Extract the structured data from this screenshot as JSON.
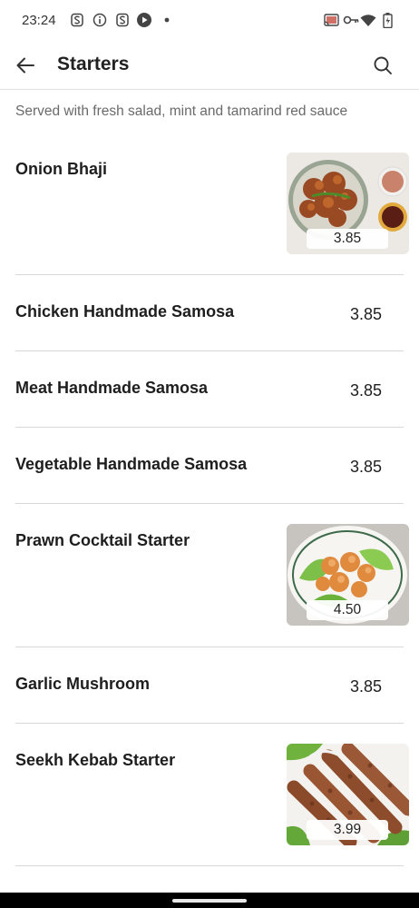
{
  "status_bar": {
    "time": "23:24",
    "icons": [
      "s-app-icon",
      "info-icon",
      "s-app-icon",
      "media-icon",
      "dot-icon",
      "cast-icon",
      "vpn-key-icon",
      "wifi-icon",
      "battery-icon"
    ]
  },
  "app_bar": {
    "title": "Starters",
    "back_icon": "arrow-left-icon",
    "search_icon": "search-icon"
  },
  "subtitle": "Served with fresh salad, mint and tamarind red sauce",
  "items": [
    {
      "name": "Onion Bhaji",
      "price": "3.85",
      "has_image": true,
      "image": "onion-bhaji-photo"
    },
    {
      "name": "Chicken Handmade Samosa",
      "price": "3.85",
      "has_image": false
    },
    {
      "name": "Meat Handmade Samosa",
      "price": "3.85",
      "has_image": false
    },
    {
      "name": "Vegetable Handmade Samosa",
      "price": "3.85",
      "has_image": false
    },
    {
      "name": "Prawn Cocktail Starter",
      "price": "4.50",
      "has_image": true,
      "image": "prawn-photo"
    },
    {
      "name": "Garlic Mushroom",
      "price": "3.85",
      "has_image": false
    },
    {
      "name": "Seekh Kebab Starter",
      "price": "3.99",
      "has_image": true,
      "image": "seekh-kebab-photo"
    }
  ],
  "colors": {
    "divider": "#d8d8d8",
    "text": "#1e1e1e",
    "subtitle": "#6a6a6a",
    "nav_bar": "#000000"
  }
}
